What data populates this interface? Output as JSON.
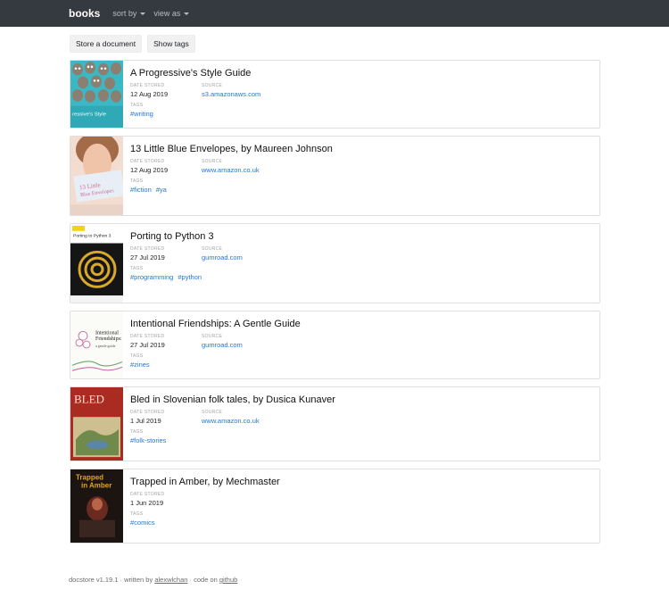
{
  "navbar": {
    "brand": "books",
    "sort_by": "sort by",
    "view_as": "view as"
  },
  "actions": {
    "store": "Store a document",
    "show_tags": "Show tags"
  },
  "labels": {
    "date_stored": "DATE STORED",
    "source": "SOURCE",
    "tags": "TAGS"
  },
  "documents": [
    {
      "title": "A Progressive's Style Guide",
      "date": "12 Aug 2019",
      "source": "s3.amazonaws.com",
      "tags": [
        "#writing"
      ],
      "cover_text": "ressive's Style"
    },
    {
      "title": "13 Little Blue Envelopes, by Maureen Johnson",
      "date": "12 Aug 2019",
      "source": "www.amazon.co.uk",
      "tags": [
        "#fiction",
        "#ya"
      ],
      "cover_text": "13 Little Blue Envelopes"
    },
    {
      "title": "Porting to Python 3",
      "date": "27 Jul 2019",
      "source": "gumroad.com",
      "tags": [
        "#programming",
        "#python"
      ],
      "cover_text": "Porting to Python 3"
    },
    {
      "title": "Intentional Friendships: A Gentle Guide",
      "date": "27 Jul 2019",
      "source": "gumroad.com",
      "tags": [
        "#zines"
      ],
      "cover_text": "Intentional Friendships"
    },
    {
      "title": "Bled in Slovenian folk tales, by Dusica Kunaver",
      "date": "1 Jul 2019",
      "source": "www.amazon.co.uk",
      "tags": [
        "#folk-stories"
      ],
      "cover_text": "BLED"
    },
    {
      "title": "Trapped in Amber, by Mechmaster",
      "date": "1 Jun 2019",
      "source": null,
      "tags": [
        "#comics"
      ],
      "cover_text": "Trapped in Amber"
    }
  ],
  "footer": {
    "prefix": "docstore v1.19.1 · written by",
    "author": "alexwlchan",
    "middle": "· code on",
    "repo": "github"
  }
}
